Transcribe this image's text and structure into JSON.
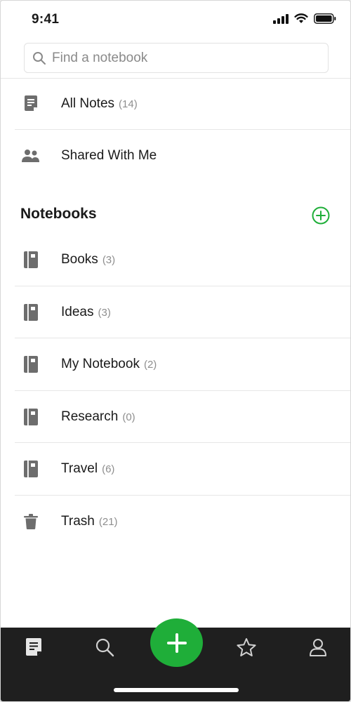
{
  "status_bar": {
    "time": "9:41",
    "icons": [
      "signal-icon",
      "wifi-icon",
      "battery-icon"
    ]
  },
  "search": {
    "placeholder": "Find a notebook",
    "value": ""
  },
  "quick_items": [
    {
      "label": "All Notes",
      "count": "(14)",
      "icon": "note-icon"
    },
    {
      "label": "Shared With Me",
      "count": "",
      "icon": "people-icon"
    }
  ],
  "notebooks_section": {
    "title": "Notebooks",
    "add_icon": "plus-circle-icon"
  },
  "notebooks": [
    {
      "label": "Books",
      "count": "(3)",
      "icon": "notebook-icon"
    },
    {
      "label": "Ideas",
      "count": "(3)",
      "icon": "notebook-icon"
    },
    {
      "label": "My Notebook",
      "count": "(2)",
      "icon": "notebook-icon"
    },
    {
      "label": "Research",
      "count": "(0)",
      "icon": "notebook-icon"
    },
    {
      "label": "Travel",
      "count": "(6)",
      "icon": "notebook-icon"
    }
  ],
  "trash": {
    "label": "Trash",
    "count": "(21)",
    "icon": "trash-icon"
  },
  "tab_bar": {
    "tabs": [
      "notes-tab-icon",
      "search-icon",
      "new-note-icon",
      "star-icon",
      "account-icon"
    ],
    "active": "notes-tab-icon"
  },
  "colors": {
    "accent": "#1fae39",
    "icon_gray": "#6d6d6d",
    "tab_bar_bg": "#1f1f1f"
  }
}
